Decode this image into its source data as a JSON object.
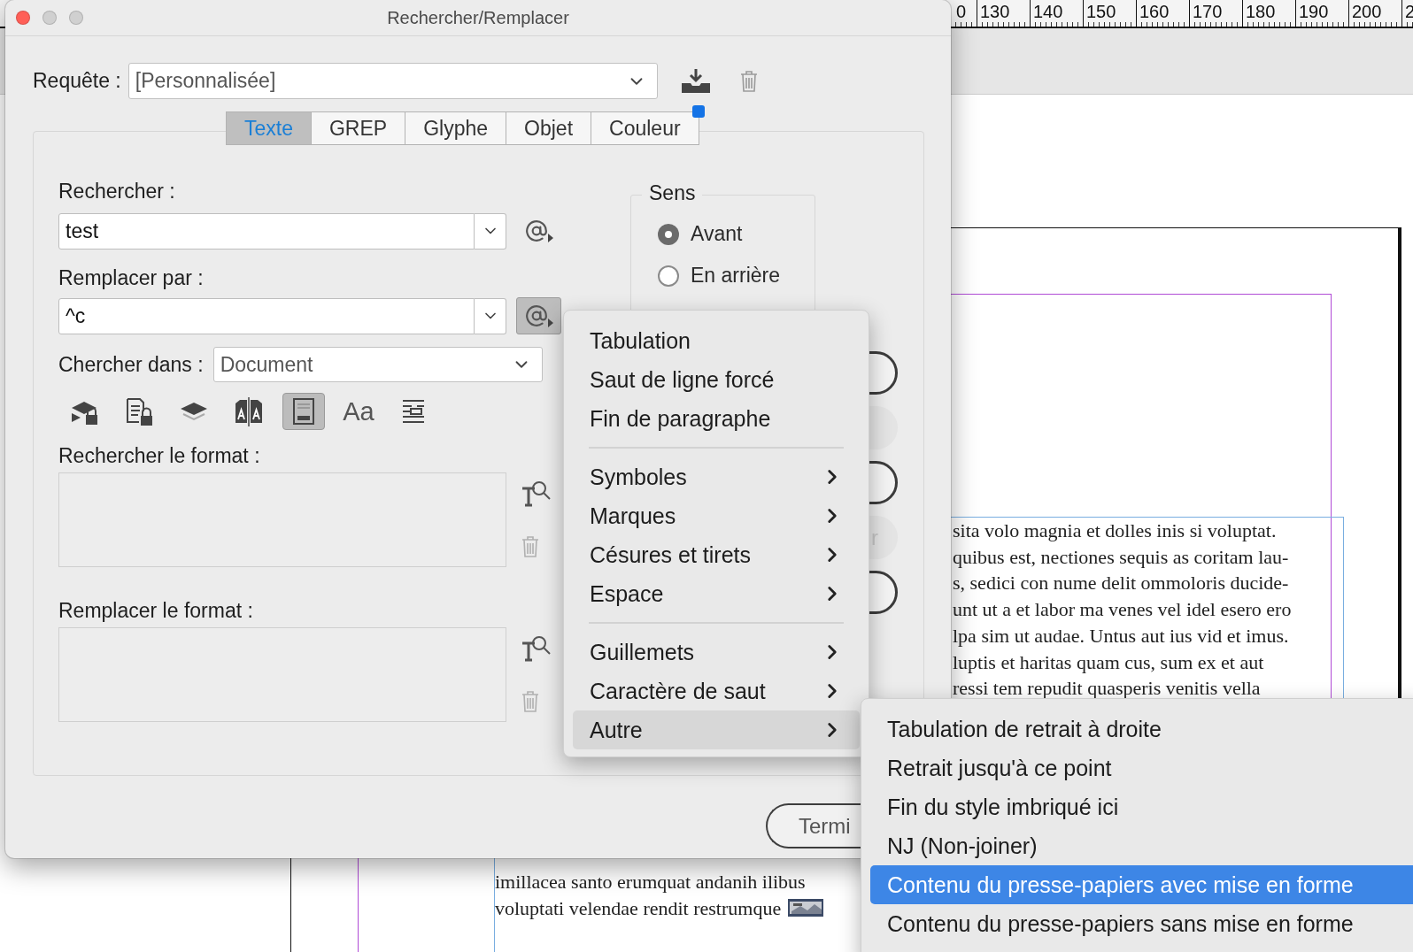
{
  "ruler": {
    "labels": [
      "0",
      "130",
      "140",
      "150",
      "160",
      "170",
      "180",
      "190",
      "200",
      "2"
    ]
  },
  "document": {
    "upper_lines": [
      "sita volo magnia et dolles inis si voluptat.",
      "quibus est, nectiones sequis as coritam lau-",
      "s, sedici con nume delit ommoloris ducide-",
      "unt ut a et labor ma venes vel idel esero ero",
      "lpa sim ut audae. Untus aut ius vid et imus.",
      "luptis et haritas quam cus, sum ex et aut",
      "ressi tem repudit quasperis venitis vella"
    ],
    "lower_lines": [
      "imillacea santo erumquat andanih ilibus",
      "voluptati velendae rendit restrumque"
    ]
  },
  "dialog": {
    "title": "Rechercher/Remplacer",
    "query": {
      "label": "Requête :",
      "value": "[Personnalisée]"
    },
    "tabs": [
      {
        "label": "Texte",
        "selected": true,
        "indicator": false
      },
      {
        "label": "GREP",
        "selected": false,
        "indicator": false
      },
      {
        "label": "Glyphe",
        "selected": false,
        "indicator": false
      },
      {
        "label": "Objet",
        "selected": false,
        "indicator": false
      },
      {
        "label": "Couleur",
        "selected": false,
        "indicator": true
      }
    ],
    "find": {
      "label": "Rechercher :",
      "value": "test",
      "special_pressed": false
    },
    "replace": {
      "label": "Remplacer par :",
      "value": "^c",
      "special_pressed": true
    },
    "search_in": {
      "label": "Chercher dans :",
      "value": "Document"
    },
    "options": [
      {
        "kind": "locked-layers",
        "selected": false
      },
      {
        "kind": "locked-stories",
        "selected": false
      },
      {
        "kind": "hidden-layers",
        "selected": false
      },
      {
        "kind": "master-pages",
        "selected": false
      },
      {
        "kind": "footnotes",
        "selected": true
      },
      {
        "kind": "case",
        "label": "Aa",
        "selected": false
      },
      {
        "kind": "whole-word",
        "selected": false
      }
    ],
    "find_format": {
      "label": "Rechercher le format :"
    },
    "replace_format": {
      "label": "Remplacer le format :"
    },
    "direction": {
      "label": "Sens",
      "options": [
        {
          "label": "Avant",
          "selected": true
        },
        {
          "label": "En arrière",
          "selected": false
        }
      ]
    },
    "side_buttons": [
      {
        "disabled": false
      },
      {
        "disabled": true
      },
      {
        "disabled": false
      },
      {
        "disabled": true,
        "label": "r"
      },
      {
        "disabled": false
      }
    ],
    "done_button": "Termi"
  },
  "menu": {
    "items": [
      {
        "kind": "item",
        "label": "Tabulation",
        "selected": false
      },
      {
        "kind": "item",
        "label": "Saut de ligne forcé",
        "selected": false
      },
      {
        "kind": "item",
        "label": "Fin de paragraphe",
        "selected": false
      },
      {
        "kind": "separator"
      },
      {
        "kind": "submenu",
        "label": "Symboles",
        "selected": false
      },
      {
        "kind": "submenu",
        "label": "Marques",
        "selected": false
      },
      {
        "kind": "submenu",
        "label": "Césures et tirets",
        "selected": false
      },
      {
        "kind": "submenu",
        "label": "Espace",
        "selected": false
      },
      {
        "kind": "separator"
      },
      {
        "kind": "submenu",
        "label": "Guillemets",
        "selected": false
      },
      {
        "kind": "submenu",
        "label": "Caractère de saut",
        "selected": false
      },
      {
        "kind": "submenu",
        "label": "Autre",
        "selected": true
      }
    ]
  },
  "submenu": {
    "items": [
      {
        "kind": "item",
        "label": "Tabulation de retrait à droite",
        "selected": false
      },
      {
        "kind": "item",
        "label": "Retrait jusqu'à ce point",
        "selected": false
      },
      {
        "kind": "item",
        "label": "Fin du style imbriqué ici",
        "selected": false
      },
      {
        "kind": "item",
        "label": "NJ (Non-joiner)",
        "selected": false
      },
      {
        "kind": "item",
        "label": "Contenu du presse-papiers avec mise en forme",
        "selected": true
      },
      {
        "kind": "item",
        "label": "Contenu du presse-papiers sans mise en forme",
        "selected": false
      }
    ]
  }
}
